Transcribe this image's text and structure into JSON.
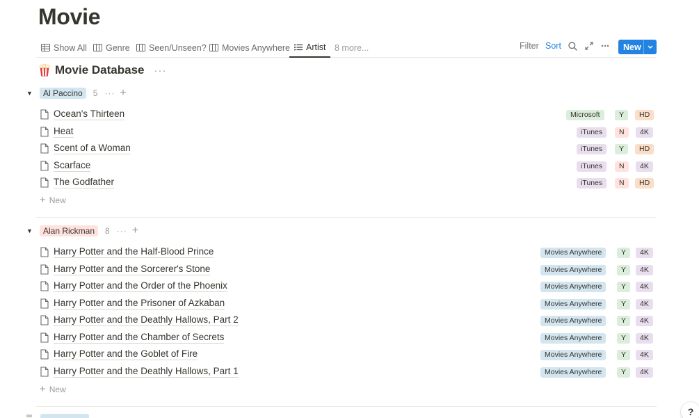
{
  "page_title": "Movie",
  "views": {
    "tabs": [
      {
        "label": "Show All",
        "icon": "table-icon"
      },
      {
        "label": "Genre",
        "icon": "board-icon"
      },
      {
        "label": "Seen/Unseen?",
        "icon": "board-icon"
      },
      {
        "label": "Movies Anywhere",
        "icon": "board-icon"
      },
      {
        "label": "Artist",
        "icon": "list-icon",
        "active": true
      }
    ],
    "more_label": "8 more..."
  },
  "toolbar": {
    "filter_label": "Filter",
    "sort_label": "Sort",
    "new_label": "New"
  },
  "database": {
    "icon": "popcorn-icon",
    "title": "Movie Database",
    "more": "···"
  },
  "groups": [
    {
      "name": "Al Paccino",
      "count": "5",
      "more": "···",
      "add": "+",
      "new_label": "New",
      "rows": [
        {
          "title": "Ocean's Thirteen",
          "service": "Microsoft",
          "seen": "Y",
          "quality": "HD"
        },
        {
          "title": "Heat",
          "service": "iTunes",
          "seen": "N",
          "quality": "4K"
        },
        {
          "title": "Scent of a Woman",
          "service": "iTunes",
          "seen": "Y",
          "quality": "HD"
        },
        {
          "title": "Scarface",
          "service": "iTunes",
          "seen": "N",
          "quality": "4K"
        },
        {
          "title": "The Godfather",
          "service": "iTunes",
          "seen": "N",
          "quality": "HD"
        }
      ]
    },
    {
      "name": "Alan Rickman",
      "count": "8",
      "more": "···",
      "add": "+",
      "new_label": "New",
      "rows": [
        {
          "title": "Harry Potter and the Half-Blood Prince",
          "service": "Movies Anywhere",
          "seen": "Y",
          "quality": "4K"
        },
        {
          "title": "Harry Potter and the Sorcerer's Stone",
          "service": "Movies Anywhere",
          "seen": "Y",
          "quality": "4K"
        },
        {
          "title": "Harry Potter and the Order of the Phoenix",
          "service": "Movies Anywhere",
          "seen": "Y",
          "quality": "4K"
        },
        {
          "title": "Harry Potter and the Prisoner of Azkaban",
          "service": "Movies Anywhere",
          "seen": "Y",
          "quality": "4K"
        },
        {
          "title": "Harry Potter and the Deathly Hallows, Part 2",
          "service": "Movies Anywhere",
          "seen": "Y",
          "quality": "4K"
        },
        {
          "title": "Harry Potter and the Chamber of Secrets",
          "service": "Movies Anywhere",
          "seen": "Y",
          "quality": "4K"
        },
        {
          "title": "Harry Potter and the Goblet of Fire",
          "service": "Movies Anywhere",
          "seen": "Y",
          "quality": "4K"
        },
        {
          "title": "Harry Potter and the Deathly Hallows, Part 1",
          "service": "Movies Anywhere",
          "seen": "Y",
          "quality": "4K"
        }
      ]
    }
  ],
  "help_label": "?",
  "colors": {
    "accent": "#2383e2",
    "text": "#37352f",
    "muted": "#9b9a97"
  }
}
